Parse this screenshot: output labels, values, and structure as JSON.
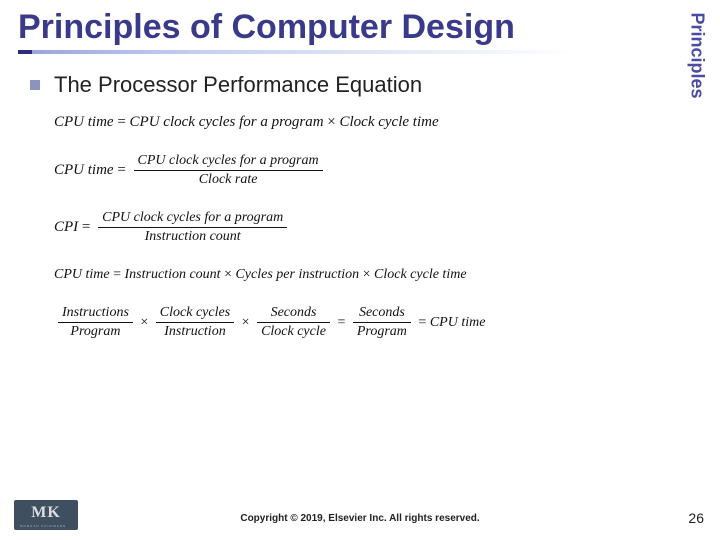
{
  "side_tab": "Principles",
  "title": "Principles of Computer Design",
  "bullet": "The Processor Performance Equation",
  "eq1": {
    "lhs": "CPU time",
    "a": "CPU clock cycles for a program",
    "op": "×",
    "b": "Clock cycle time"
  },
  "eq2": {
    "lhs": "CPU time",
    "num": "CPU clock cycles for a program",
    "den": "Clock rate"
  },
  "eq3": {
    "lhs": "CPI",
    "num": "CPU clock cycles for a program",
    "den": "Instruction count"
  },
  "eq4": {
    "lhs": "CPU time",
    "a": "Instruction count",
    "b": "Cycles per instruction",
    "c": "Clock cycle time",
    "op": "×"
  },
  "eq5": {
    "f1": {
      "num": "Instructions",
      "den": "Program"
    },
    "f2": {
      "num": "Clock cycles",
      "den": "Instruction"
    },
    "f3": {
      "num": "Seconds",
      "den": "Clock cycle"
    },
    "f4": {
      "num": "Seconds",
      "den": "Program"
    },
    "rhs": "CPU time",
    "op": "×",
    "eq": "="
  },
  "logo": {
    "letters": "MK",
    "sub": "MORGAN KAUFMANN"
  },
  "copyright": "Copyright © 2019, Elsevier Inc. All rights reserved.",
  "page_number": "26"
}
